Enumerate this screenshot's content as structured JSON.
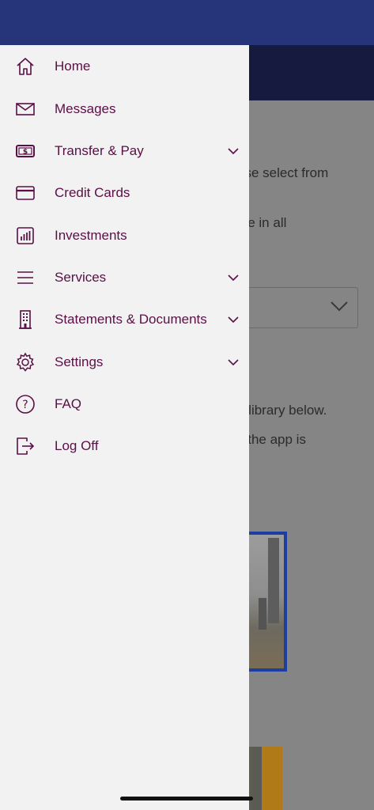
{
  "background": {
    "lines": [
      "ase select from",
      "ble in all",
      "e library below.",
      "y the app is"
    ]
  },
  "menu": {
    "items": [
      {
        "label": "Home",
        "icon": "home-icon",
        "expandable": false
      },
      {
        "label": "Messages",
        "icon": "envelope-icon",
        "expandable": false
      },
      {
        "label": "Transfer & Pay",
        "icon": "dollar-bill-icon",
        "expandable": true
      },
      {
        "label": "Credit Cards",
        "icon": "credit-card-icon",
        "expandable": false
      },
      {
        "label": "Investments",
        "icon": "bar-chart-icon",
        "expandable": false
      },
      {
        "label": "Services",
        "icon": "hamburger-icon",
        "expandable": true
      },
      {
        "label": "Statements & Documents",
        "icon": "building-icon",
        "expandable": true
      },
      {
        "label": "Settings",
        "icon": "gear-icon",
        "expandable": true
      },
      {
        "label": "FAQ",
        "icon": "question-icon",
        "expandable": false
      },
      {
        "label": "Log Off",
        "icon": "logout-icon",
        "expandable": false
      }
    ]
  },
  "colors": {
    "accent": "#5a0f45",
    "status_bar": "#26347a",
    "header": "#151a3e",
    "drawer_bg": "#f2f2f2",
    "image_border": "#1b3ea0"
  }
}
